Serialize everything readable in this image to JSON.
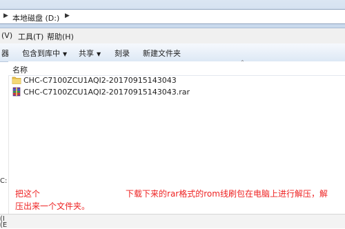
{
  "address": {
    "path": "本地磁盘 (D:)"
  },
  "menu": [
    "(V)",
    "工具(T)",
    "帮助(H)"
  ],
  "toolbar": {
    "items": [
      "器",
      "包含到库中",
      "共享",
      "刻录",
      "新建文件夹"
    ]
  },
  "columns": {
    "name": "名称"
  },
  "files": [
    {
      "name": "CHC-C7100ZCU1AQI2-20170915143043",
      "icon": "folder-icon"
    },
    {
      "name": "CHC-C7100ZCU1AQI2-20170915143043.rar",
      "icon": "rar-archive-icon"
    }
  ],
  "left_fragments": [
    "C:",
    "(I",
    "(E"
  ],
  "caption": {
    "part1": "把这个",
    "part2": "下载下来的rar格式的rom线刷包在电脑上进行解压，解压出来一个文件夹。"
  },
  "colors": {
    "caption": "#ee2222",
    "folder": "#e8c04a"
  }
}
